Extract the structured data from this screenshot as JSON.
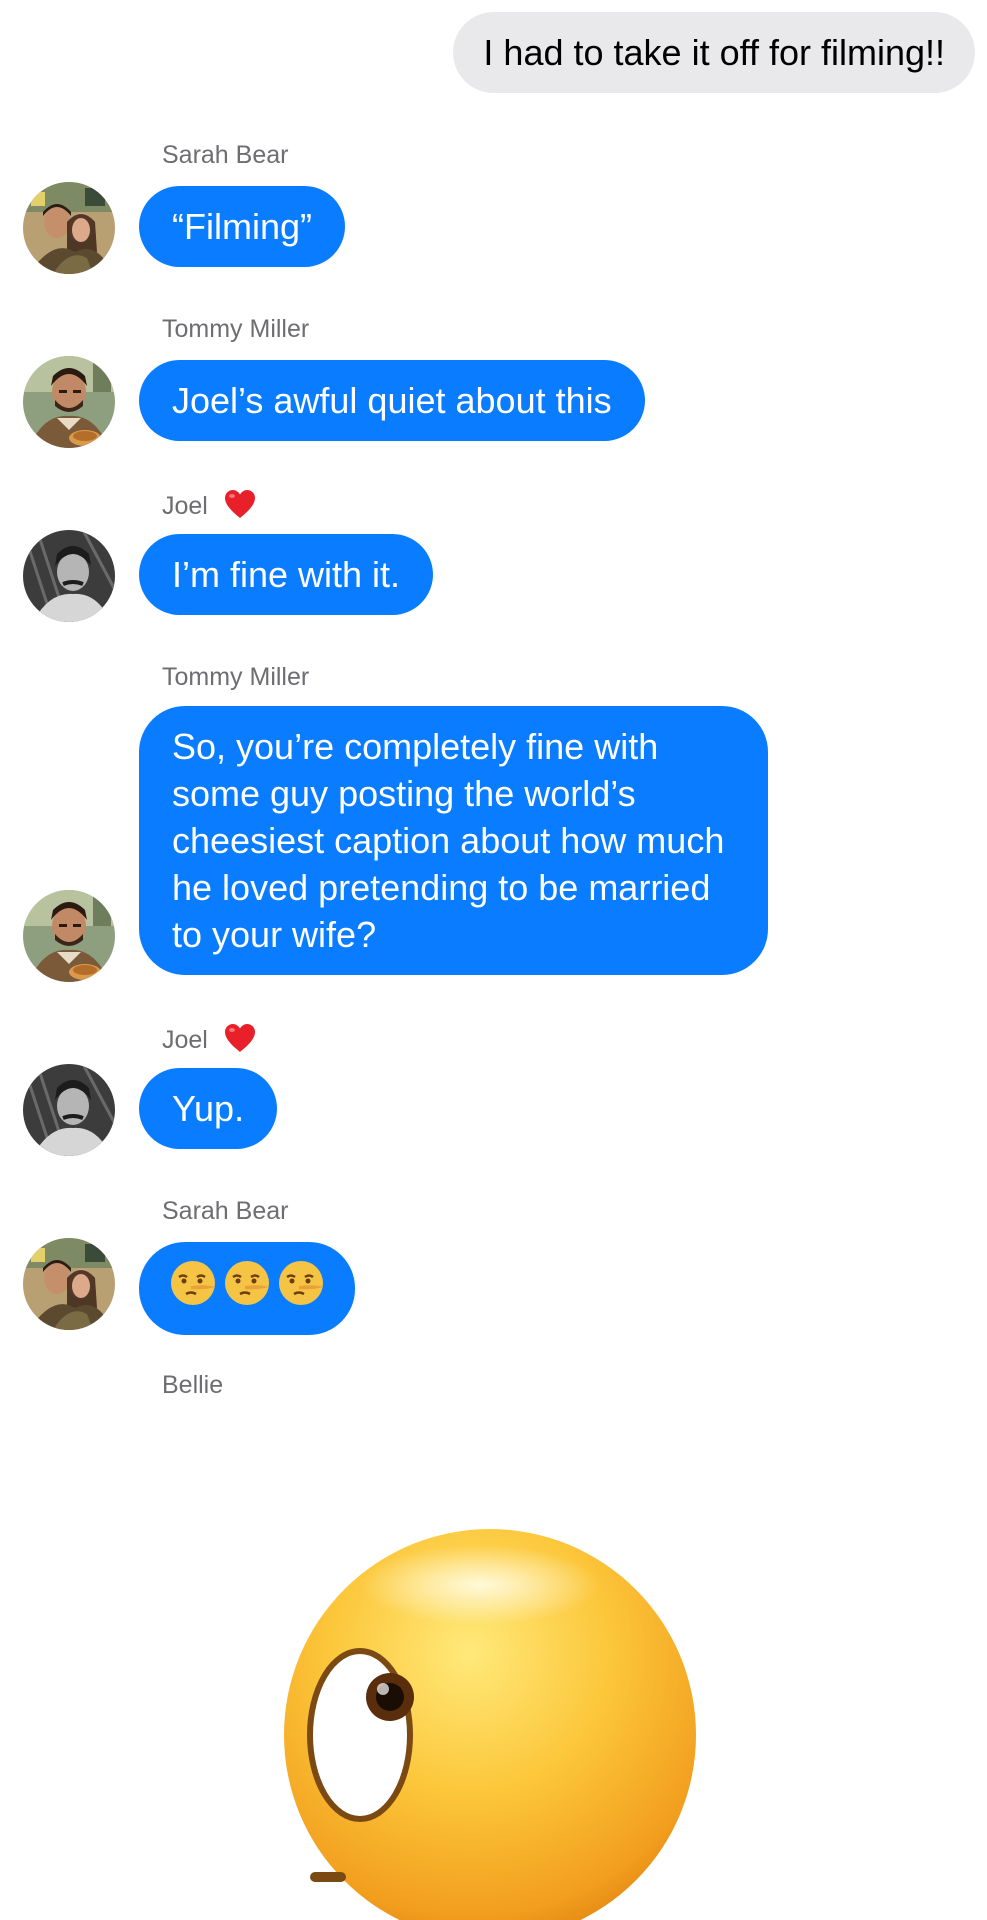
{
  "messages": [
    {
      "direction": "outgoing",
      "text": "I had to take it off for filming!!"
    },
    {
      "direction": "incoming",
      "sender": "Sarah Bear",
      "text": "“Filming”",
      "avatar": "sarah-bear-avatar"
    },
    {
      "direction": "incoming",
      "sender": "Tommy Miller",
      "text": "Joel’s awful quiet about this",
      "avatar": "tommy-miller-avatar"
    },
    {
      "direction": "incoming",
      "sender": "Joel",
      "sender_badge": "red-heart-icon",
      "text": "I’m fine with it.",
      "avatar": "joel-avatar"
    },
    {
      "direction": "incoming",
      "sender": "Tommy Miller",
      "text": "So, you’re completely fine with some guy posting the world’s cheesiest caption about how much he loved pretending to be married to your wife?",
      "avatar": "tommy-miller-avatar"
    },
    {
      "direction": "incoming",
      "sender": "Joel",
      "sender_badge": "red-heart-icon",
      "text": "Yup.",
      "avatar": "joel-avatar"
    },
    {
      "direction": "incoming",
      "sender": "Sarah Bear",
      "emojis": [
        "lying-face-emoji",
        "lying-face-emoji",
        "lying-face-emoji"
      ],
      "avatar": "sarah-bear-avatar"
    },
    {
      "direction": "incoming",
      "sender": "Bellie",
      "sticker": "face-with-rolling-eyes-emoji"
    }
  ],
  "colors": {
    "incoming_bubble": "#0a7cff",
    "outgoing_bubble": "#e9e9eb",
    "sender_name": "#6d6d72",
    "heart": "#e8202a"
  }
}
